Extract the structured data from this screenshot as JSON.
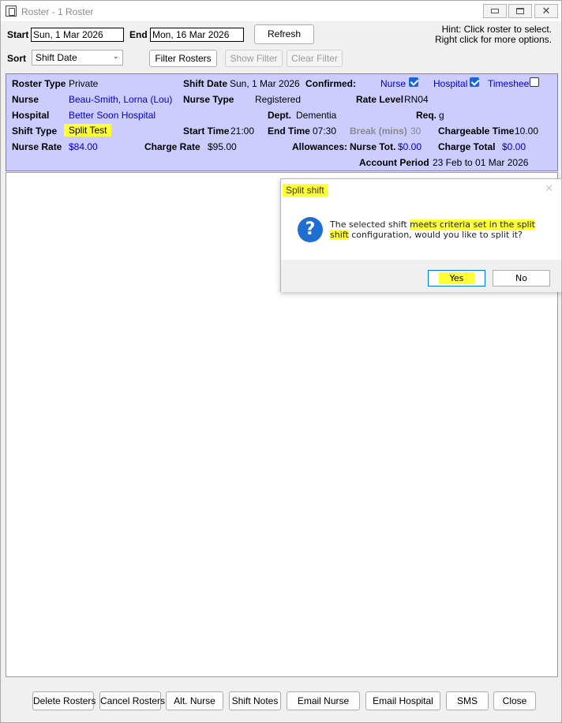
{
  "window": {
    "title": "Roster - 1 Roster"
  },
  "filters": {
    "start_label": "Start",
    "start_value": "Sun, 1 Mar 2026",
    "end_label": "End",
    "end_value": "Mon, 16 Mar 2026",
    "refresh_label": "Refresh",
    "sort_label": "Sort",
    "sort_value": "Shift Date",
    "filter_label": "Filter Rosters",
    "show_filter_label": "Show Filter",
    "clear_filter_label": "Clear Filter",
    "hint_line1": "Hint: Click roster to select.",
    "hint_line2": "Right click for more options."
  },
  "roster": {
    "roster_type_label": "Roster Type",
    "roster_type": "Private",
    "shift_date_label": "Shift Date",
    "shift_date": "Sun, 1 Mar 2026",
    "confirmed_label": "Confirmed:",
    "confirmed_nurse": "Nurse",
    "confirmed_hospital": "Hospital",
    "confirmed_timesheet": "Timesheet",
    "nurse_label": "Nurse",
    "nurse": "Beau-Smith, Lorna  (Lou)",
    "nurse_type_label": "Nurse Type",
    "nurse_type": "Registered",
    "rate_level_label": "Rate Level",
    "rate_level": "RN04",
    "hospital_label": "Hospital",
    "hospital": "Better Soon Hospital",
    "dept_label": "Dept.",
    "dept": "Dementia",
    "req_label": "Req.",
    "req": "g",
    "shift_type_label": "Shift Type",
    "shift_type": "Split Test",
    "start_time_label": "Start Time",
    "start_time": "21:00",
    "end_time_label": "End Time",
    "end_time": "07:30",
    "break_label": "Break (mins)",
    "break": "30",
    "chargeable_label": "Chargeable Time",
    "chargeable": "10.00",
    "nurse_rate_label": "Nurse Rate",
    "nurse_rate": "$84.00",
    "charge_rate_label": "Charge Rate",
    "charge_rate": "$95.00",
    "allowances_label": "Allowances:",
    "nurse_tot_label": "Nurse Tot.",
    "nurse_tot": "$0.00",
    "charge_total_label": "Charge Total",
    "charge_total": "$0.00",
    "account_period_label": "Account Period",
    "account_period": "23 Feb to 01 Mar 2026"
  },
  "dialog": {
    "title": "Split shift",
    "msg_part1": "The selected shift ",
    "msg_highlight": "meets criteria set in the split shift",
    "msg_part2": " configuration, would you like to split it?",
    "yes": "Yes",
    "no": "No"
  },
  "actions": {
    "delete": "Delete Rosters",
    "cancel": "Cancel Rosters",
    "alt_nurse": "Alt. Nurse",
    "shift_notes": "Shift Notes",
    "email_nurse": "Email Nurse",
    "email_hospital": "Email Hospital",
    "sms": "SMS",
    "close": "Close"
  },
  "colors": {
    "panel": "#ccccff",
    "highlight": "#ffff33",
    "link_blue": "#0000c8"
  }
}
